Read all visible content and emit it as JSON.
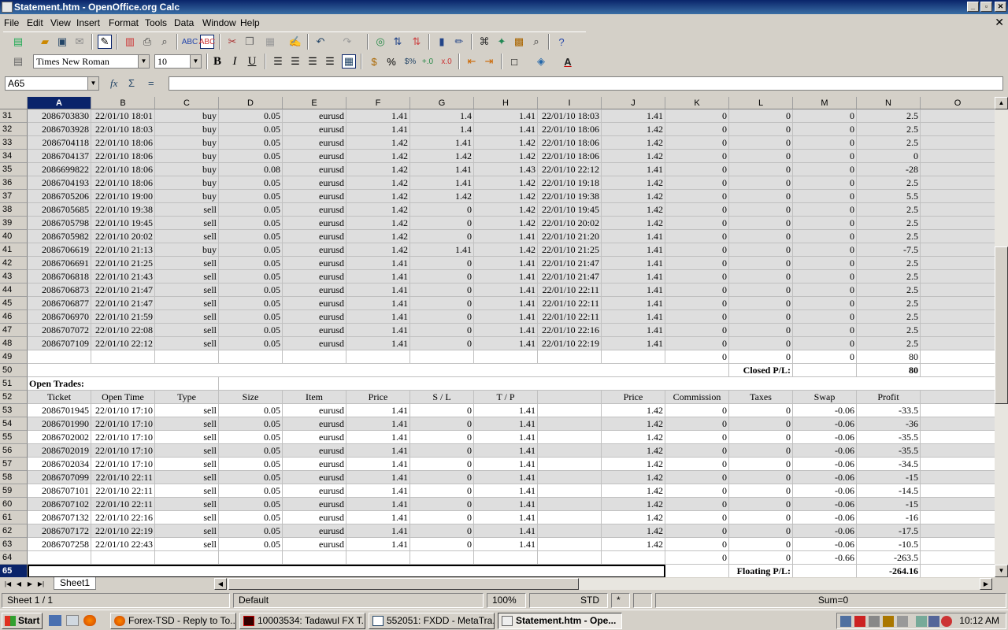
{
  "window": {
    "title": "Statement.htm - OpenOffice.org Calc"
  },
  "menu": [
    "File",
    "Edit",
    "View",
    "Insert",
    "Format",
    "Tools",
    "Data",
    "Window",
    "Help"
  ],
  "format_bar": {
    "font": "Times New Roman",
    "size": "10"
  },
  "formula_bar": {
    "cell": "A65",
    "content": ""
  },
  "columns": [
    "A",
    "B",
    "C",
    "D",
    "E",
    "F",
    "G",
    "H",
    "I",
    "J",
    "K",
    "L",
    "M",
    "N",
    "O"
  ],
  "closed_rows": [
    [
      "31",
      "2086703830",
      "22/01/10 18:01",
      "buy",
      "0.05",
      "eurusd",
      "1.41",
      "1.4",
      "1.41",
      "22/01/10 18:03",
      "1.41",
      "0",
      "0",
      "0",
      "2.5"
    ],
    [
      "32",
      "2086703928",
      "22/01/10 18:03",
      "buy",
      "0.05",
      "eurusd",
      "1.41",
      "1.4",
      "1.41",
      "22/01/10 18:06",
      "1.42",
      "0",
      "0",
      "0",
      "2.5"
    ],
    [
      "33",
      "2086704118",
      "22/01/10 18:06",
      "buy",
      "0.05",
      "eurusd",
      "1.42",
      "1.41",
      "1.42",
      "22/01/10 18:06",
      "1.42",
      "0",
      "0",
      "0",
      "2.5"
    ],
    [
      "34",
      "2086704137",
      "22/01/10 18:06",
      "buy",
      "0.05",
      "eurusd",
      "1.42",
      "1.42",
      "1.42",
      "22/01/10 18:06",
      "1.42",
      "0",
      "0",
      "0",
      "0"
    ],
    [
      "35",
      "2086699822",
      "22/01/10 18:06",
      "buy",
      "0.08",
      "eurusd",
      "1.42",
      "1.41",
      "1.43",
      "22/01/10 22:12",
      "1.41",
      "0",
      "0",
      "0",
      "-28"
    ],
    [
      "36",
      "2086704193",
      "22/01/10 18:06",
      "buy",
      "0.05",
      "eurusd",
      "1.42",
      "1.41",
      "1.42",
      "22/01/10 19:18",
      "1.42",
      "0",
      "0",
      "0",
      "2.5"
    ],
    [
      "37",
      "2086705206",
      "22/01/10 19:00",
      "buy",
      "0.05",
      "eurusd",
      "1.42",
      "1.42",
      "1.42",
      "22/01/10 19:38",
      "1.42",
      "0",
      "0",
      "0",
      "5.5"
    ],
    [
      "38",
      "2086705685",
      "22/01/10 19:38",
      "sell",
      "0.05",
      "eurusd",
      "1.42",
      "0",
      "1.42",
      "22/01/10 19:45",
      "1.42",
      "0",
      "0",
      "0",
      "2.5"
    ],
    [
      "39",
      "2086705798",
      "22/01/10 19:45",
      "sell",
      "0.05",
      "eurusd",
      "1.42",
      "0",
      "1.42",
      "22/01/10 20:02",
      "1.42",
      "0",
      "0",
      "0",
      "2.5"
    ],
    [
      "40",
      "2086705982",
      "22/01/10 20:02",
      "sell",
      "0.05",
      "eurusd",
      "1.42",
      "0",
      "1.41",
      "22/01/10 21:20",
      "1.41",
      "0",
      "0",
      "0",
      "2.5"
    ],
    [
      "41",
      "2086706619",
      "22/01/10 21:13",
      "buy",
      "0.05",
      "eurusd",
      "1.42",
      "1.41",
      "1.42",
      "22/01/10 21:25",
      "1.41",
      "0",
      "0",
      "0",
      "-7.5"
    ],
    [
      "42",
      "2086706691",
      "22/01/10 21:25",
      "sell",
      "0.05",
      "eurusd",
      "1.41",
      "0",
      "1.41",
      "22/01/10 21:47",
      "1.41",
      "0",
      "0",
      "0",
      "2.5"
    ],
    [
      "43",
      "2086706818",
      "22/01/10 21:43",
      "sell",
      "0.05",
      "eurusd",
      "1.41",
      "0",
      "1.41",
      "22/01/10 21:47",
      "1.41",
      "0",
      "0",
      "0",
      "2.5"
    ],
    [
      "44",
      "2086706873",
      "22/01/10 21:47",
      "sell",
      "0.05",
      "eurusd",
      "1.41",
      "0",
      "1.41",
      "22/01/10 22:11",
      "1.41",
      "0",
      "0",
      "0",
      "2.5"
    ],
    [
      "45",
      "2086706877",
      "22/01/10 21:47",
      "sell",
      "0.05",
      "eurusd",
      "1.41",
      "0",
      "1.41",
      "22/01/10 22:11",
      "1.41",
      "0",
      "0",
      "0",
      "2.5"
    ],
    [
      "46",
      "2086706970",
      "22/01/10 21:59",
      "sell",
      "0.05",
      "eurusd",
      "1.41",
      "0",
      "1.41",
      "22/01/10 22:11",
      "1.41",
      "0",
      "0",
      "0",
      "2.5"
    ],
    [
      "47",
      "2086707072",
      "22/01/10 22:08",
      "sell",
      "0.05",
      "eurusd",
      "1.41",
      "0",
      "1.41",
      "22/01/10 22:16",
      "1.41",
      "0",
      "0",
      "0",
      "2.5"
    ],
    [
      "48",
      "2086707109",
      "22/01/10 22:12",
      "sell",
      "0.05",
      "eurusd",
      "1.41",
      "0",
      "1.41",
      "22/01/10 22:19",
      "1.41",
      "0",
      "0",
      "0",
      "2.5"
    ]
  ],
  "row49": {
    "num": "49",
    "k": "0",
    "l": "0",
    "m": "0",
    "n": "80"
  },
  "row50": {
    "num": "50",
    "label": "Closed P/L:",
    "value": "80"
  },
  "row51": {
    "num": "51",
    "label": "Open Trades:"
  },
  "open_header": {
    "num": "52",
    "cells": [
      "Ticket",
      "Open Time",
      "Type",
      "Size",
      "Item",
      "Price",
      "S / L",
      "T / P",
      "",
      "Price",
      "Commission",
      "Taxes",
      "Swap",
      "Profit"
    ]
  },
  "open_rows": [
    [
      "53",
      "2086701945",
      "22/01/10 17:10",
      "sell",
      "0.05",
      "eurusd",
      "1.41",
      "0",
      "1.41",
      "",
      "1.42",
      "0",
      "0",
      "-0.06",
      "-33.5"
    ],
    [
      "54",
      "2086701990",
      "22/01/10 17:10",
      "sell",
      "0.05",
      "eurusd",
      "1.41",
      "0",
      "1.41",
      "",
      "1.42",
      "0",
      "0",
      "-0.06",
      "-36"
    ],
    [
      "55",
      "2086702002",
      "22/01/10 17:10",
      "sell",
      "0.05",
      "eurusd",
      "1.41",
      "0",
      "1.41",
      "",
      "1.42",
      "0",
      "0",
      "-0.06",
      "-35.5"
    ],
    [
      "56",
      "2086702019",
      "22/01/10 17:10",
      "sell",
      "0.05",
      "eurusd",
      "1.41",
      "0",
      "1.41",
      "",
      "1.42",
      "0",
      "0",
      "-0.06",
      "-35.5"
    ],
    [
      "57",
      "2086702034",
      "22/01/10 17:10",
      "sell",
      "0.05",
      "eurusd",
      "1.41",
      "0",
      "1.41",
      "",
      "1.42",
      "0",
      "0",
      "-0.06",
      "-34.5"
    ],
    [
      "58",
      "2086707099",
      "22/01/10 22:11",
      "sell",
      "0.05",
      "eurusd",
      "1.41",
      "0",
      "1.41",
      "",
      "1.42",
      "0",
      "0",
      "-0.06",
      "-15"
    ],
    [
      "59",
      "2086707101",
      "22/01/10 22:11",
      "sell",
      "0.05",
      "eurusd",
      "1.41",
      "0",
      "1.41",
      "",
      "1.42",
      "0",
      "0",
      "-0.06",
      "-14.5"
    ],
    [
      "60",
      "2086707102",
      "22/01/10 22:11",
      "sell",
      "0.05",
      "eurusd",
      "1.41",
      "0",
      "1.41",
      "",
      "1.42",
      "0",
      "0",
      "-0.06",
      "-15"
    ],
    [
      "61",
      "2086707132",
      "22/01/10 22:16",
      "sell",
      "0.05",
      "eurusd",
      "1.41",
      "0",
      "1.41",
      "",
      "1.42",
      "0",
      "0",
      "-0.06",
      "-16"
    ],
    [
      "62",
      "2086707172",
      "22/01/10 22:19",
      "sell",
      "0.05",
      "eurusd",
      "1.41",
      "0",
      "1.41",
      "",
      "1.42",
      "0",
      "0",
      "-0.06",
      "-17.5"
    ],
    [
      "63",
      "2086707258",
      "22/01/10 22:43",
      "sell",
      "0.05",
      "eurusd",
      "1.41",
      "0",
      "1.41",
      "",
      "1.42",
      "0",
      "0",
      "-0.06",
      "-10.5"
    ]
  ],
  "row64": {
    "num": "64",
    "k": "0",
    "l": "0",
    "m": "-0.66",
    "n": "-263.5"
  },
  "row65": {
    "num": "65",
    "label": "Floating P/L:",
    "value": "-264.16"
  },
  "sheet_tab": "Sheet1",
  "status": {
    "sheet": "Sheet 1 / 1",
    "style": "Default",
    "zoom": "100%",
    "mode": "STD",
    "modified": "*",
    "sum": "Sum=0"
  },
  "taskbar": {
    "start": "Start",
    "tasks": [
      "Forex-TSD - Reply to To...",
      "10003534: Tadawul FX T...",
      "552051: FXDD - MetaTra...",
      "Statement.htm - Ope..."
    ],
    "clock": "10:12 AM"
  }
}
